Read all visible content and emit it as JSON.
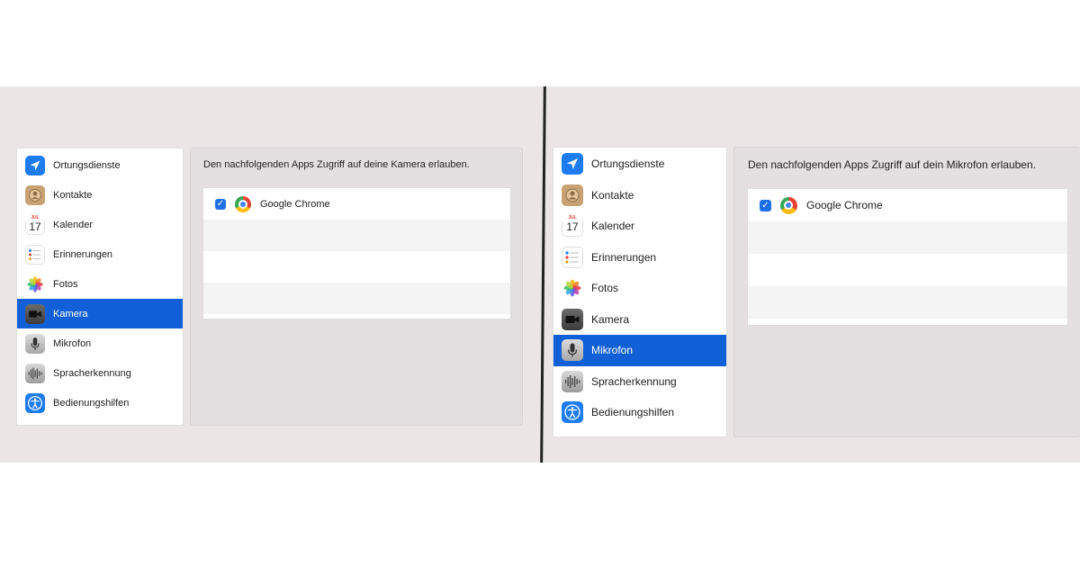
{
  "colors": {
    "accent": "#1260d8",
    "band": "#ebe5e6"
  },
  "panels": [
    {
      "selected": "Kamera",
      "sidebar": [
        {
          "label": "Ortungsdienste",
          "icon": "location-arrow-icon"
        },
        {
          "label": "Kontakte",
          "icon": "contacts-icon"
        },
        {
          "label": "Kalender",
          "icon": "calendar-icon",
          "icon_month": "JUL",
          "icon_day": "17"
        },
        {
          "label": "Erinnerungen",
          "icon": "reminders-icon"
        },
        {
          "label": "Fotos",
          "icon": "photos-icon"
        },
        {
          "label": "Kamera",
          "icon": "camera-icon"
        },
        {
          "label": "Mikrofon",
          "icon": "microphone-icon"
        },
        {
          "label": "Spracherkennung",
          "icon": "speech-recognition-icon"
        },
        {
          "label": "Bedienungshilfen",
          "icon": "accessibility-icon"
        }
      ],
      "description": "Den nachfolgenden Apps Zugriff auf deine Kamera erlauben.",
      "apps": [
        {
          "name": "Google Chrome",
          "checked": true
        }
      ]
    },
    {
      "selected": "Mikrofon",
      "sidebar": [
        {
          "label": "Ortungsdienste",
          "icon": "location-arrow-icon"
        },
        {
          "label": "Kontakte",
          "icon": "contacts-icon"
        },
        {
          "label": "Kalender",
          "icon": "calendar-icon",
          "icon_month": "JUL",
          "icon_day": "17"
        },
        {
          "label": "Erinnerungen",
          "icon": "reminders-icon"
        },
        {
          "label": "Fotos",
          "icon": "photos-icon"
        },
        {
          "label": "Kamera",
          "icon": "camera-icon"
        },
        {
          "label": "Mikrofon",
          "icon": "microphone-icon"
        },
        {
          "label": "Spracherkennung",
          "icon": "speech-recognition-icon"
        },
        {
          "label": "Bedienungshilfen",
          "icon": "accessibility-icon"
        }
      ],
      "description": "Den nachfolgenden Apps Zugriff auf dein Mikrofon erlauben.",
      "apps": [
        {
          "name": "Google Chrome",
          "checked": true
        }
      ]
    }
  ]
}
